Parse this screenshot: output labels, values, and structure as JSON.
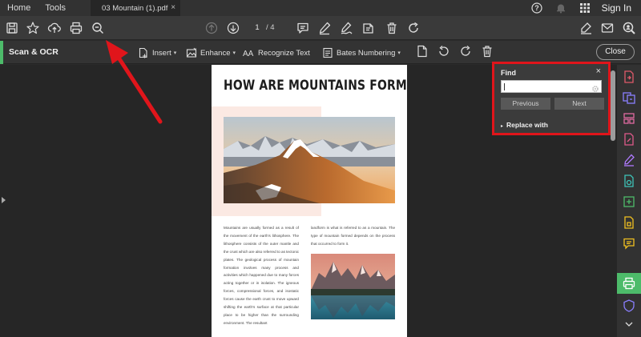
{
  "menubar": {
    "home": "Home",
    "tools": "Tools",
    "doc_tab": "03 Mountain (1).pdf",
    "doc_tab_close": "×",
    "sign_in": "Sign In"
  },
  "toolbar": {
    "page_current": "1",
    "page_total": "/ 4"
  },
  "ocrbar": {
    "title": "Scan & OCR",
    "insert": "Insert",
    "enhance": "Enhance",
    "recognize_text": "Recognize Text",
    "bates_numbering": "Bates Numbering",
    "caret": "▾",
    "close": "Close"
  },
  "document": {
    "title": "HOW ARE MOUNTAINS FORMED?",
    "col1": "Mountains are usually formed as a result of the movement of the earth's lithosphere. The lithosphere consists of the outer mantle and the crust which are also referred to as tectonic plates. The geological process of mountain formation involves many process and activities which happened due to many forces acting together or in isolation. The igneous forces, compressional forces, and isostatic forces cause the earth crust to move upward shifting the earth's surface at that particular place to be higher than the surrounding environment. The resultant",
    "col2": "landform is what is referred to as a mountain. The type of mountain formed depends on the process that occurred to form it."
  },
  "find_panel": {
    "title": "Find",
    "close": "×",
    "search_value": "",
    "previous": "Previous",
    "next": "Next",
    "replace_arrow": "▸",
    "replace_with": "Replace with"
  },
  "colors": {
    "accent_green": "#4dbb6a",
    "highlight_red": "#e0151b"
  }
}
